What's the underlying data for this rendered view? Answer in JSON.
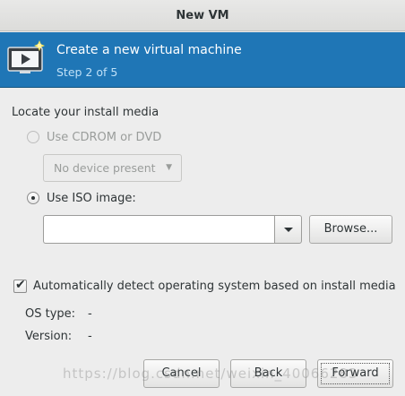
{
  "window": {
    "title": "New VM"
  },
  "banner": {
    "title": "Create a new virtual machine",
    "step": "Step 2 of 5",
    "icon": "vm-monitor-icon",
    "bg_color": "#1f76b6"
  },
  "media": {
    "section_label": "Locate your install media",
    "cdrom_label": "Use CDROM or DVD",
    "cdrom_selected": false,
    "cdrom_enabled": false,
    "device_combo_value": "No device present",
    "iso_label": "Use ISO image:",
    "iso_selected": true,
    "iso_path_value": "",
    "browse_label": "Browse..."
  },
  "os_detect": {
    "auto_detect_label": "Automatically detect operating system based on install media",
    "auto_detect_checked": true,
    "os_type_label": "OS type:",
    "os_type_value": "-",
    "version_label": "Version:",
    "version_value": "-"
  },
  "footer": {
    "cancel_label": "Cancel",
    "back_label": "Back",
    "forward_label": "Forward"
  },
  "watermark": {
    "text": "https://blog.csdn.net/weixin_40066283"
  }
}
